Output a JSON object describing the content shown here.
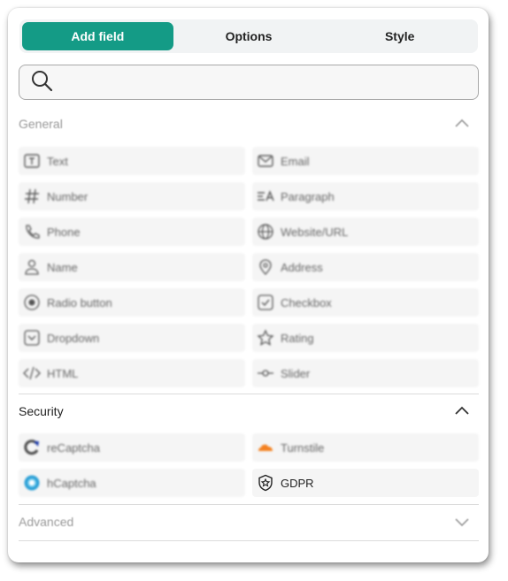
{
  "tabs": [
    {
      "label": "Add field",
      "active": true
    },
    {
      "label": "Options",
      "active": false
    },
    {
      "label": "Style",
      "active": false
    }
  ],
  "search": {
    "placeholder": "",
    "value": "",
    "icon": "search-icon"
  },
  "sections": {
    "general": {
      "title": "General",
      "expanded": true,
      "items": [
        {
          "label": "Text",
          "icon": "text-icon"
        },
        {
          "label": "Email",
          "icon": "mail-icon"
        },
        {
          "label": "Number",
          "icon": "hash-icon"
        },
        {
          "label": "Paragraph",
          "icon": "paragraph-icon"
        },
        {
          "label": "Phone",
          "icon": "phone-icon"
        },
        {
          "label": "Website/URL",
          "icon": "globe-icon"
        },
        {
          "label": "Name",
          "icon": "person-icon"
        },
        {
          "label": "Address",
          "icon": "map-pin-icon"
        },
        {
          "label": "Radio button",
          "icon": "radio-icon"
        },
        {
          "label": "Checkbox",
          "icon": "checkbox-icon"
        },
        {
          "label": "Dropdown",
          "icon": "dropdown-icon"
        },
        {
          "label": "Rating",
          "icon": "star-icon"
        },
        {
          "label": "HTML",
          "icon": "code-icon"
        },
        {
          "label": "Slider",
          "icon": "slider-icon"
        }
      ]
    },
    "security": {
      "title": "Security",
      "expanded": true,
      "items": [
        {
          "label": "reCaptcha",
          "icon": "recaptcha-icon"
        },
        {
          "label": "Turnstile",
          "icon": "cloudflare-icon"
        },
        {
          "label": "hCaptcha",
          "icon": "hcaptcha-icon"
        },
        {
          "label": "GDPR",
          "icon": "shield-star-icon"
        }
      ]
    },
    "advanced": {
      "title": "Advanced",
      "expanded": false
    }
  },
  "colors": {
    "accent": "#149b86",
    "cloudflare": "#f48120",
    "hcaptcha": "#2a9fd6"
  }
}
